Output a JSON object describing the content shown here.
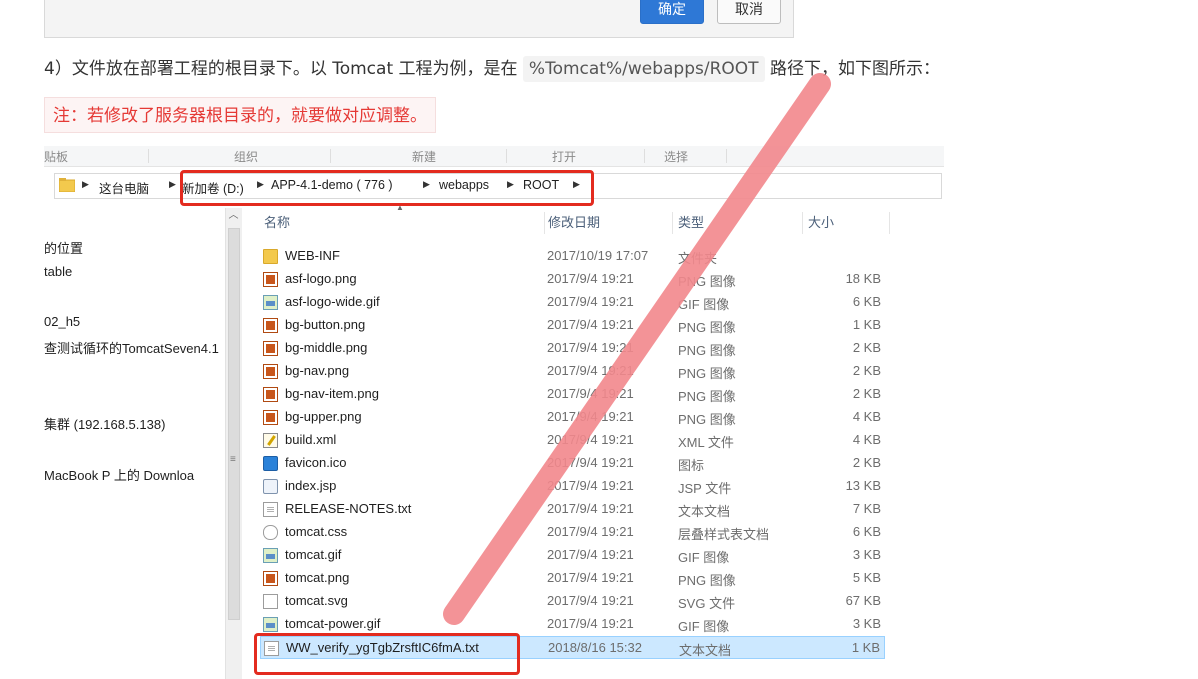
{
  "dialog": {
    "ok_label": "确定",
    "cancel_label": "取消"
  },
  "paragraph": {
    "prefix": "4）文件放在部署工程的根目录下。以 Tomcat 工程为例，是在 ",
    "code": "%Tomcat%/webapps/ROOT",
    "suffix": " 路径下，如下图所示："
  },
  "note": "注：若修改了服务器根目录的，就要做对应调整。",
  "explorer": {
    "ribbon": [
      "贴板",
      "组织",
      "新建",
      "打开",
      "选择"
    ],
    "breadcrumb": [
      "这台电脑",
      "新加卷 (D:)",
      "APP-4.1-demo ( 776 )",
      "webapps",
      "ROOT"
    ],
    "nav_items": [
      "的位置",
      "table",
      "02_h5",
      "查测试循环的TomcatSeven4.1",
      "集群 (192.168.5.138)",
      "MacBook P 上的 Downloa"
    ],
    "columns": {
      "name": "名称",
      "date": "修改日期",
      "type": "类型",
      "size": "大小"
    },
    "files": [
      {
        "name": "WEB-INF",
        "date": "2017/10/19 17:07",
        "type": "文件夹",
        "size": "",
        "icon": "folder-icon"
      },
      {
        "name": "asf-logo.png",
        "date": "2017/9/4 19:21",
        "type": "PNG 图像",
        "size": "18 KB",
        "icon": "png-file-icon"
      },
      {
        "name": "asf-logo-wide.gif",
        "date": "2017/9/4 19:21",
        "type": "GIF 图像",
        "size": "6 KB",
        "icon": "gif-file-icon"
      },
      {
        "name": "bg-button.png",
        "date": "2017/9/4 19:21",
        "type": "PNG 图像",
        "size": "1 KB",
        "icon": "png-file-icon"
      },
      {
        "name": "bg-middle.png",
        "date": "2017/9/4 19:21",
        "type": "PNG 图像",
        "size": "2 KB",
        "icon": "png-file-icon"
      },
      {
        "name": "bg-nav.png",
        "date": "2017/9/4 19:21",
        "type": "PNG 图像",
        "size": "2 KB",
        "icon": "png-file-icon"
      },
      {
        "name": "bg-nav-item.png",
        "date": "2017/9/4 19:21",
        "type": "PNG 图像",
        "size": "2 KB",
        "icon": "png-file-icon"
      },
      {
        "name": "bg-upper.png",
        "date": "2017/9/4 19:21",
        "type": "PNG 图像",
        "size": "4 KB",
        "icon": "png-file-icon"
      },
      {
        "name": "build.xml",
        "date": "2017/9/4 19:21",
        "type": "XML 文件",
        "size": "4 KB",
        "icon": "xml-file-icon"
      },
      {
        "name": "favicon.ico",
        "date": "2017/9/4 19:21",
        "type": "图标",
        "size": "2 KB",
        "icon": "ico-file-icon"
      },
      {
        "name": "index.jsp",
        "date": "2017/9/4 19:21",
        "type": "JSP 文件",
        "size": "13 KB",
        "icon": "jsp-file-icon"
      },
      {
        "name": "RELEASE-NOTES.txt",
        "date": "2017/9/4 19:21",
        "type": "文本文档",
        "size": "7 KB",
        "icon": "txt-file-icon"
      },
      {
        "name": "tomcat.css",
        "date": "2017/9/4 19:21",
        "type": "层叠样式表文档",
        "size": "6 KB",
        "icon": "css-file-icon"
      },
      {
        "name": "tomcat.gif",
        "date": "2017/9/4 19:21",
        "type": "GIF 图像",
        "size": "3 KB",
        "icon": "gif-file-icon"
      },
      {
        "name": "tomcat.png",
        "date": "2017/9/4 19:21",
        "type": "PNG 图像",
        "size": "5 KB",
        "icon": "png-file-icon"
      },
      {
        "name": "tomcat.svg",
        "date": "2017/9/4 19:21",
        "type": "SVG 文件",
        "size": "67 KB",
        "icon": "svg-file-icon"
      },
      {
        "name": "tomcat-power.gif",
        "date": "2017/9/4 19:21",
        "type": "GIF 图像",
        "size": "3 KB",
        "icon": "gif-file-icon"
      },
      {
        "name": "WW_verify_ygTgbZrsftIC6fmA.txt",
        "date": "2018/8/16 15:32",
        "type": "文本文档",
        "size": "1 KB",
        "icon": "txt-file-icon",
        "selected": true
      }
    ]
  },
  "colors": {
    "accent_blue": "#2e78d6",
    "highlight_red": "#e32b1f",
    "note_red": "#e53935",
    "selection": "#cce8ff"
  }
}
